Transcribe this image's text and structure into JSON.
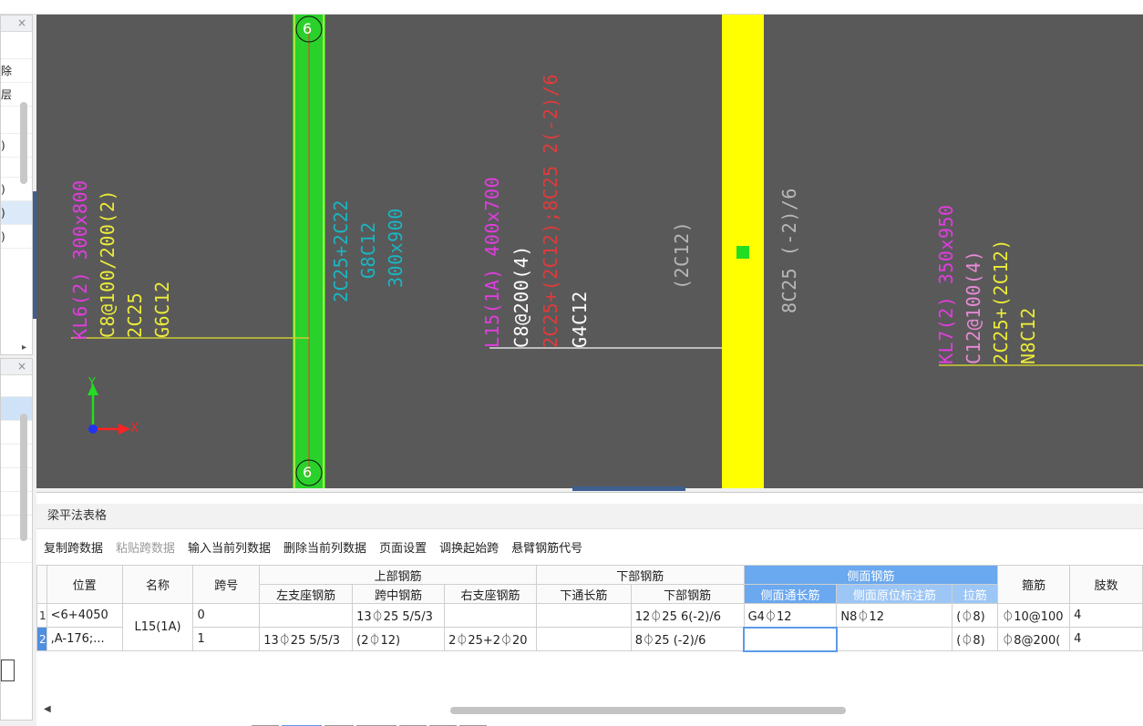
{
  "colors": {
    "canvas_bg": "#595959",
    "magenta": "#e23de0",
    "yellow": "#ecec3a",
    "white": "#ffffff",
    "red": "#e23a3a",
    "cyan": "#19b6c4",
    "gray_text": "#b8b8b8",
    "green_col": "#2ad12a",
    "yellow_col": "#ffff00"
  },
  "left_panel_top": {
    "rows": [
      "除",
      "层",
      ")",
      ")",
      ")",
      ")"
    ],
    "close": "×",
    "arrow": "▸"
  },
  "left_panel_bottom": {
    "close": "×"
  },
  "canvas": {
    "axis_label": "6",
    "axis_label_bottom": "6",
    "coord": {
      "y_label": "Y",
      "x_label": "X"
    },
    "beam_kl6": [
      "KL6(2) 300x800",
      "C8@100/200(2)",
      "2C25",
      "G6C12"
    ],
    "column_label": [
      "2C25+2C22",
      "G8C12",
      "300x900"
    ],
    "beam_l15": [
      "L15(1A) 400x700",
      "C8@200(4)",
      "2C25+(2C12);8C25 2(-2)/6",
      "G4C12"
    ],
    "mid_label": "(2C12)",
    "right_label": "8C25 (-2)/6",
    "beam_kl7": [
      "KL7(2) 350x950",
      "C12@100(4)",
      "2C25+(2C12)",
      "N8C12"
    ]
  },
  "table_panel": {
    "title": "梁平法表格",
    "toolbar": [
      "复制跨数据",
      "粘贴跨数据",
      "输入当前列数据",
      "删除当前列数据",
      "页面设置",
      "调换起始跨",
      "悬臂钢筋代号"
    ],
    "headers": {
      "position": "位置",
      "name": "名称",
      "span": "跨号",
      "top_group": "上部钢筋",
      "top_left": "左支座钢筋",
      "top_mid": "跨中钢筋",
      "top_right": "右支座钢筋",
      "bottom_group": "下部钢筋",
      "bottom_through": "下通长筋",
      "bottom_bar": "下部钢筋",
      "side_group": "侧面钢筋",
      "side_through": "侧面通长筋",
      "side_orig": "侧面原位标注筋",
      "tie": "拉筋",
      "stirrup": "箍筋",
      "legs": "肢数"
    },
    "rows": [
      {
        "rownum": "1",
        "position": "<6+4050",
        "name": "L15(1A)",
        "span": "0",
        "top_left": "",
        "top_mid": "13⏀25 5/5/3",
        "top_right": "",
        "bottom_through": "",
        "bottom_bar": "12⏀25 6(-2)/6",
        "side_through": "G4⏀12",
        "side_orig": "N8⏀12",
        "tie": "(⏀8)",
        "stirrup": "⏀10@100",
        "legs": "4"
      },
      {
        "rownum": "2",
        "position": ",A-176;...",
        "name": "",
        "span": "1",
        "top_left": "13⏀25 5/5/3",
        "top_mid": "(2⏀12)",
        "top_right": "2⏀25+2⏀20",
        "bottom_through": "",
        "bottom_bar": "8⏀25 (-2)/6",
        "side_through": "",
        "side_orig": "",
        "tie": "(⏀8)",
        "stirrup": "⏀8@200(",
        "legs": "4"
      }
    ]
  }
}
